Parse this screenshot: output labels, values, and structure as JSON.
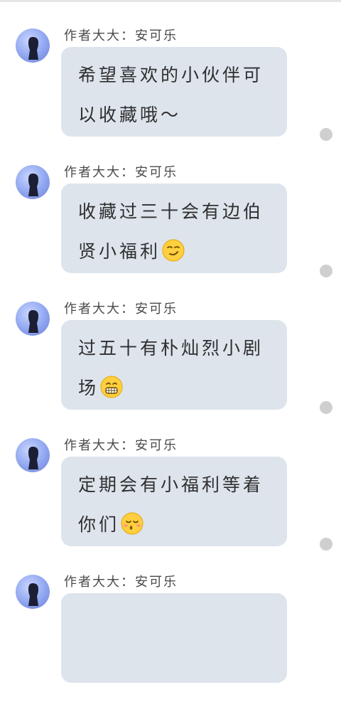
{
  "messages": [
    {
      "author": "作者大大：安可乐",
      "text": "希望喜欢的小伙伴可以收藏哦～",
      "emoji": ""
    },
    {
      "author": "作者大大：安可乐",
      "text": "收藏过三十会有边伯贤小福利",
      "emoji": "smirk-emoji"
    },
    {
      "author": "作者大大：安可乐",
      "text": "过五十有朴灿烈小剧场",
      "emoji": "grimace-emoji"
    },
    {
      "author": "作者大大：安可乐",
      "text": "定期会有小福利等着你们",
      "emoji": "kissing-emoji"
    },
    {
      "author": "作者大大：安可乐",
      "text": "",
      "emoji": ""
    }
  ],
  "colors": {
    "bubble": "#dde4ec",
    "avatar": "#8fa5f0",
    "status_dot": "#cfcfcf"
  }
}
